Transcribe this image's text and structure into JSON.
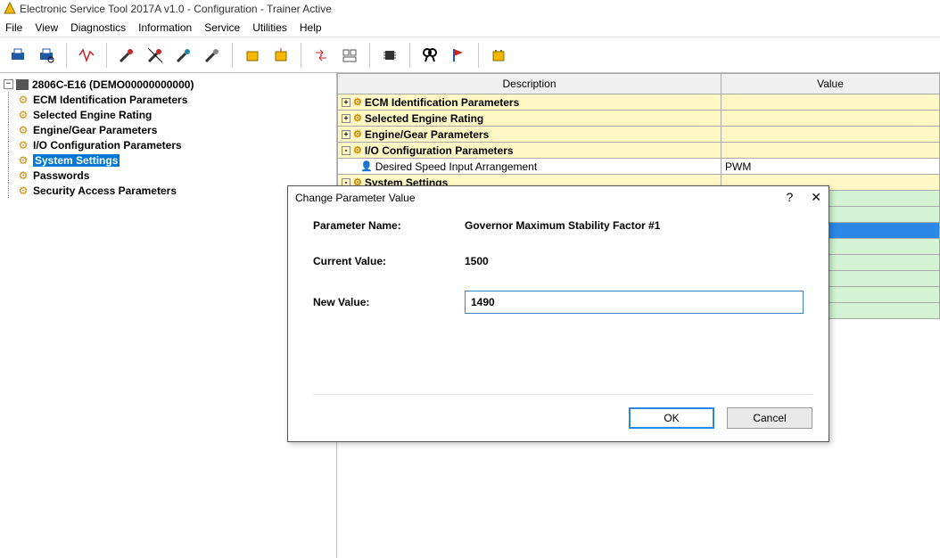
{
  "window": {
    "title": "Electronic Service Tool 2017A v1.0 - Configuration - Trainer Active"
  },
  "menubar": [
    "File",
    "View",
    "Diagnostics",
    "Information",
    "Service",
    "Utilities",
    "Help"
  ],
  "toolbar_icons": [
    "print-icon",
    "print-preview-icon",
    "waveform-icon",
    "tool-a-icon",
    "tool-b-icon",
    "tool-c-icon",
    "tool-d-icon",
    "paint-a-icon",
    "paint-b-icon",
    "swap-icon",
    "layout-icon",
    "chip-icon",
    "search-icon",
    "flag-icon",
    "battery-icon"
  ],
  "tree": {
    "root": "2806C-E16 (DEMO00000000000)",
    "children": [
      "ECM Identification Parameters",
      "Selected Engine Rating",
      "Engine/Gear Parameters",
      "I/O Configuration Parameters",
      "System Settings",
      "Passwords",
      "Security Access Parameters"
    ],
    "selected": "System Settings"
  },
  "grid": {
    "headers": {
      "description": "Description",
      "value": "Value"
    },
    "rows": [
      {
        "type": "yellow",
        "exp": "+",
        "icon": "gear",
        "desc": "ECM Identification Parameters",
        "value": ""
      },
      {
        "type": "yellow",
        "exp": "+",
        "icon": "gear",
        "desc": "Selected Engine Rating",
        "value": ""
      },
      {
        "type": "yellow",
        "exp": "+",
        "icon": "gear",
        "desc": "Engine/Gear Parameters",
        "value": ""
      },
      {
        "type": "yellow",
        "exp": "-",
        "icon": "gear",
        "desc": "I/O Configuration Parameters",
        "value": ""
      },
      {
        "type": "white",
        "icon": "person",
        "indent": 1,
        "desc": "Desired Speed Input Arrangement",
        "value": "PWM"
      },
      {
        "type": "yellow",
        "exp": "-",
        "icon": "gear",
        "desc": "System Settings",
        "value": ""
      },
      {
        "type": "green"
      },
      {
        "type": "green"
      },
      {
        "type": "blue"
      },
      {
        "type": "green"
      },
      {
        "type": "green"
      },
      {
        "type": "green"
      },
      {
        "type": "green"
      },
      {
        "type": "green"
      }
    ]
  },
  "dialog": {
    "title": "Change Parameter Value",
    "param_name_label": "Parameter Name:",
    "param_name_value": "Governor Maximum Stability Factor #1",
    "current_value_label": "Current Value:",
    "current_value_value": "1500",
    "new_value_label": "New Value:",
    "new_value_value": "1490",
    "ok": "OK",
    "cancel": "Cancel"
  }
}
